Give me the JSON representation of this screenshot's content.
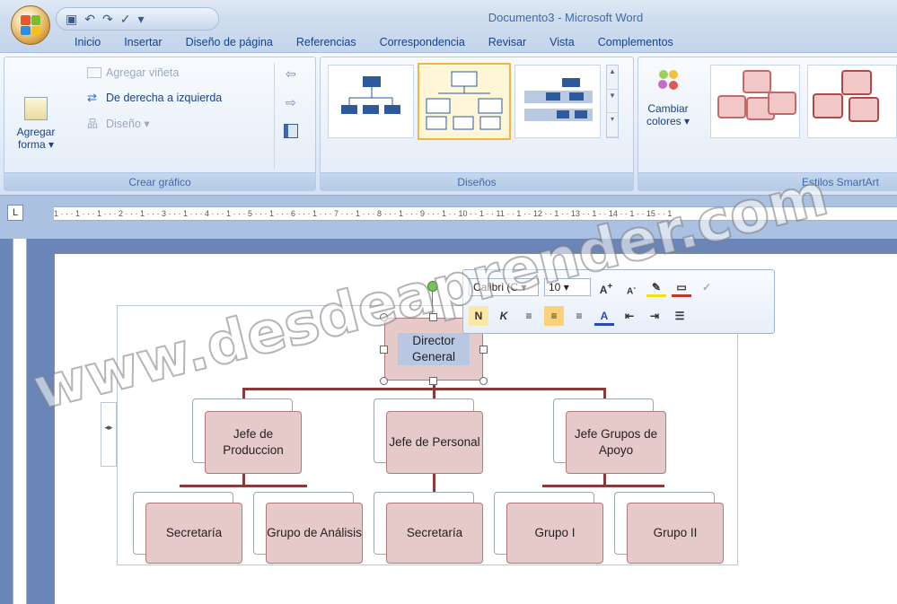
{
  "window": {
    "title": "Documento3 - Microsoft Word"
  },
  "tabs": [
    "Inicio",
    "Insertar",
    "Diseño de página",
    "Referencias",
    "Correspondencia",
    "Revisar",
    "Vista",
    "Complementos"
  ],
  "ribbon": {
    "crear_grafico": {
      "label": "Crear gráfico",
      "add_shape_line1": "Agregar",
      "add_shape_line2": "forma ▾",
      "add_bullet": "Agregar viñeta",
      "right_to_left": "De derecha a izquierda",
      "layout": "Diseño ▾"
    },
    "disenos": {
      "label": "Diseños"
    },
    "estilos": {
      "label": "Estilos SmartArt",
      "change_colors_line1": "Cambiar",
      "change_colors_line2": "colores ▾"
    }
  },
  "ruler": {
    "marks": "1 · · · 1 · · · 1 · · · 2 · · · 1 · · · 3 · · · 1 · · · 4 · · · 1 · · · 5 · · · 1 · · · 6 · · · 1 · · · 7 · · · 1 · · · 8 · · · 1 · · · 9 · · · 1 · · 10 · · 1 · · 11 · · 1 · · 12 · · 1 · · 13 · · 1 · · 14 · · 1 · · 15 · · 1"
  },
  "mini_toolbar": {
    "font": "Calibri (C",
    "size": "10"
  },
  "org_chart": {
    "director": "Director General",
    "managers": [
      "Jefe de Produccion",
      "Jefe de Personal",
      "Jefe Grupos de Apoyo"
    ],
    "staff": [
      "Secretaría",
      "Grupo de Análisis",
      "Secretaría",
      "Grupo I",
      "Grupo II"
    ]
  },
  "watermark": "www.desdeaprender.com",
  "colors": {
    "node_fill": "#e6c9c9",
    "node_border": "#b07a7a",
    "connector": "#8a3a3a",
    "accent": "#15428b"
  }
}
